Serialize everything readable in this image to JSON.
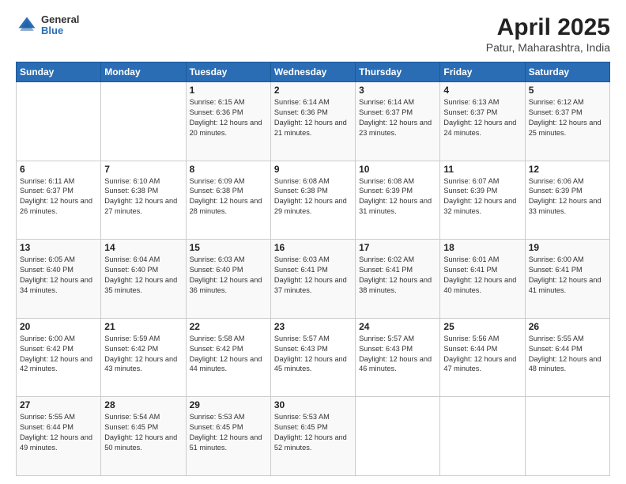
{
  "header": {
    "logo": {
      "general": "General",
      "blue": "Blue"
    },
    "title": "April 2025",
    "subtitle": "Patur, Maharashtra, India"
  },
  "days_of_week": [
    "Sunday",
    "Monday",
    "Tuesday",
    "Wednesday",
    "Thursday",
    "Friday",
    "Saturday"
  ],
  "weeks": [
    [
      null,
      null,
      {
        "day": 1,
        "sunrise": "6:15 AM",
        "sunset": "6:36 PM",
        "daylight": "12 hours and 20 minutes."
      },
      {
        "day": 2,
        "sunrise": "6:14 AM",
        "sunset": "6:36 PM",
        "daylight": "12 hours and 21 minutes."
      },
      {
        "day": 3,
        "sunrise": "6:14 AM",
        "sunset": "6:37 PM",
        "daylight": "12 hours and 23 minutes."
      },
      {
        "day": 4,
        "sunrise": "6:13 AM",
        "sunset": "6:37 PM",
        "daylight": "12 hours and 24 minutes."
      },
      {
        "day": 5,
        "sunrise": "6:12 AM",
        "sunset": "6:37 PM",
        "daylight": "12 hours and 25 minutes."
      }
    ],
    [
      {
        "day": 6,
        "sunrise": "6:11 AM",
        "sunset": "6:37 PM",
        "daylight": "12 hours and 26 minutes."
      },
      {
        "day": 7,
        "sunrise": "6:10 AM",
        "sunset": "6:38 PM",
        "daylight": "12 hours and 27 minutes."
      },
      {
        "day": 8,
        "sunrise": "6:09 AM",
        "sunset": "6:38 PM",
        "daylight": "12 hours and 28 minutes."
      },
      {
        "day": 9,
        "sunrise": "6:08 AM",
        "sunset": "6:38 PM",
        "daylight": "12 hours and 29 minutes."
      },
      {
        "day": 10,
        "sunrise": "6:08 AM",
        "sunset": "6:39 PM",
        "daylight": "12 hours and 31 minutes."
      },
      {
        "day": 11,
        "sunrise": "6:07 AM",
        "sunset": "6:39 PM",
        "daylight": "12 hours and 32 minutes."
      },
      {
        "day": 12,
        "sunrise": "6:06 AM",
        "sunset": "6:39 PM",
        "daylight": "12 hours and 33 minutes."
      }
    ],
    [
      {
        "day": 13,
        "sunrise": "6:05 AM",
        "sunset": "6:40 PM",
        "daylight": "12 hours and 34 minutes."
      },
      {
        "day": 14,
        "sunrise": "6:04 AM",
        "sunset": "6:40 PM",
        "daylight": "12 hours and 35 minutes."
      },
      {
        "day": 15,
        "sunrise": "6:03 AM",
        "sunset": "6:40 PM",
        "daylight": "12 hours and 36 minutes."
      },
      {
        "day": 16,
        "sunrise": "6:03 AM",
        "sunset": "6:41 PM",
        "daylight": "12 hours and 37 minutes."
      },
      {
        "day": 17,
        "sunrise": "6:02 AM",
        "sunset": "6:41 PM",
        "daylight": "12 hours and 38 minutes."
      },
      {
        "day": 18,
        "sunrise": "6:01 AM",
        "sunset": "6:41 PM",
        "daylight": "12 hours and 40 minutes."
      },
      {
        "day": 19,
        "sunrise": "6:00 AM",
        "sunset": "6:41 PM",
        "daylight": "12 hours and 41 minutes."
      }
    ],
    [
      {
        "day": 20,
        "sunrise": "6:00 AM",
        "sunset": "6:42 PM",
        "daylight": "12 hours and 42 minutes."
      },
      {
        "day": 21,
        "sunrise": "5:59 AM",
        "sunset": "6:42 PM",
        "daylight": "12 hours and 43 minutes."
      },
      {
        "day": 22,
        "sunrise": "5:58 AM",
        "sunset": "6:42 PM",
        "daylight": "12 hours and 44 minutes."
      },
      {
        "day": 23,
        "sunrise": "5:57 AM",
        "sunset": "6:43 PM",
        "daylight": "12 hours and 45 minutes."
      },
      {
        "day": 24,
        "sunrise": "5:57 AM",
        "sunset": "6:43 PM",
        "daylight": "12 hours and 46 minutes."
      },
      {
        "day": 25,
        "sunrise": "5:56 AM",
        "sunset": "6:44 PM",
        "daylight": "12 hours and 47 minutes."
      },
      {
        "day": 26,
        "sunrise": "5:55 AM",
        "sunset": "6:44 PM",
        "daylight": "12 hours and 48 minutes."
      }
    ],
    [
      {
        "day": 27,
        "sunrise": "5:55 AM",
        "sunset": "6:44 PM",
        "daylight": "12 hours and 49 minutes."
      },
      {
        "day": 28,
        "sunrise": "5:54 AM",
        "sunset": "6:45 PM",
        "daylight": "12 hours and 50 minutes."
      },
      {
        "day": 29,
        "sunrise": "5:53 AM",
        "sunset": "6:45 PM",
        "daylight": "12 hours and 51 minutes."
      },
      {
        "day": 30,
        "sunrise": "5:53 AM",
        "sunset": "6:45 PM",
        "daylight": "12 hours and 52 minutes."
      },
      null,
      null,
      null
    ]
  ]
}
